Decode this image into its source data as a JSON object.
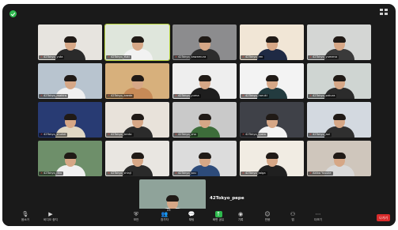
{
  "meeting": {
    "featured_name": "42Tokyo_pepe"
  },
  "participants": [
    {
      "name": "42Tokyo_yuta",
      "bg": "#e7e4df",
      "shirt": "#2a2a2a",
      "speaking": false
    },
    {
      "name": "42Tokyo_Yuki",
      "bg": "#dfe6dc",
      "shirt": "#f2f2f2",
      "speaking": true
    },
    {
      "name": "42Tokyo_kawamura",
      "bg": "#8c8c8e",
      "shirt": "#2d2d2d",
      "speaking": false
    },
    {
      "name": "42Tokyo_ren",
      "bg": "#f1e6d6",
      "shirt": "#1f2a44",
      "speaking": false
    },
    {
      "name": "42Tokyo_yumeno",
      "bg": "#d4d6d4",
      "shirt": "#3a3a3a",
      "speaking": false
    },
    {
      "name": "42Tokyo_mahiro",
      "bg": "#b8c4cf",
      "shirt": "#f0f0f0",
      "speaking": false
    },
    {
      "name": "42Tokyo_kaede",
      "bg": "#d7b07c",
      "shirt": "#c78a57",
      "speaking": false
    },
    {
      "name": "42Tokyo_yuma",
      "bg": "#eeeeee",
      "shirt": "#1e1e1e",
      "speaking": false
    },
    {
      "name": "42Tokyo_haruki",
      "bg": "#f3f3f3",
      "shirt": "#233b3f",
      "speaking": false
    },
    {
      "name": "42Tokyo_sakura",
      "bg": "#cfd5d2",
      "shirt": "#2b2b2b",
      "speaking": false
    },
    {
      "name": "42Tokyo_shuhei",
      "bg": "#283b73",
      "shirt": "#e0d7c4",
      "speaking": false
    },
    {
      "name": "42Tokyo_kento",
      "bg": "#e8e2da",
      "shirt": "#2b2b2b",
      "speaking": false
    },
    {
      "name": "42Tokyo_sho",
      "bg": "#c9c9c9",
      "shirt": "#3d6d3a",
      "speaking": false
    },
    {
      "name": "42Tokyo_ryota",
      "bg": "#3f4148",
      "shirt": "#f4f4f4",
      "speaking": false
    },
    {
      "name": "42Tokyo_aoi",
      "bg": "#d3d9e0",
      "shirt": "#2f2f2f",
      "speaking": false
    },
    {
      "name": "42Tokyo_riku",
      "bg": "#6e8f6a",
      "shirt": "#f0f0f0",
      "speaking": false
    },
    {
      "name": "42Tokyo_shinji",
      "bg": "#e9e6e1",
      "shirt": "#2a2a2a",
      "speaking": false
    },
    {
      "name": "42Tokyo_sou",
      "bg": "#dcdcdc",
      "shirt": "#2d4b7a",
      "speaking": false
    },
    {
      "name": "42Tokyo_taiga",
      "bg": "#f1ece3",
      "shirt": "#202020",
      "speaking": false
    },
    {
      "name": "Akiba Yusuke",
      "bg": "#cfc6bc",
      "shirt": "#d9d9d9",
      "speaking": false
    },
    {
      "name": "42Tokyo_pepe",
      "bg": "#8fa39a",
      "shirt": "#f3f3f3",
      "speaking": false
    }
  ],
  "toolbar": {
    "items": [
      {
        "icon": "mic-icon",
        "glyph": "🎙",
        "label": "음소거"
      },
      {
        "icon": "video-icon",
        "glyph": "▶",
        "label": "비디오 중지"
      },
      {
        "icon": "security-icon",
        "glyph": "⛨",
        "label": "보안"
      },
      {
        "icon": "participants-icon",
        "glyph": "👥",
        "label": "참가자",
        "count": "23"
      },
      {
        "icon": "chat-icon",
        "glyph": "💬",
        "label": "채팅"
      },
      {
        "icon": "share-icon",
        "glyph": "↑",
        "label": "화면 공유"
      },
      {
        "icon": "record-icon",
        "glyph": "◉",
        "label": "기록"
      },
      {
        "icon": "reactions-icon",
        "glyph": "☺",
        "label": "반응"
      },
      {
        "icon": "apps-icon",
        "glyph": "⚇",
        "label": "앱"
      },
      {
        "icon": "more-icon",
        "glyph": "⋯",
        "label": "더보기"
      }
    ],
    "leave_label": "나가기"
  }
}
